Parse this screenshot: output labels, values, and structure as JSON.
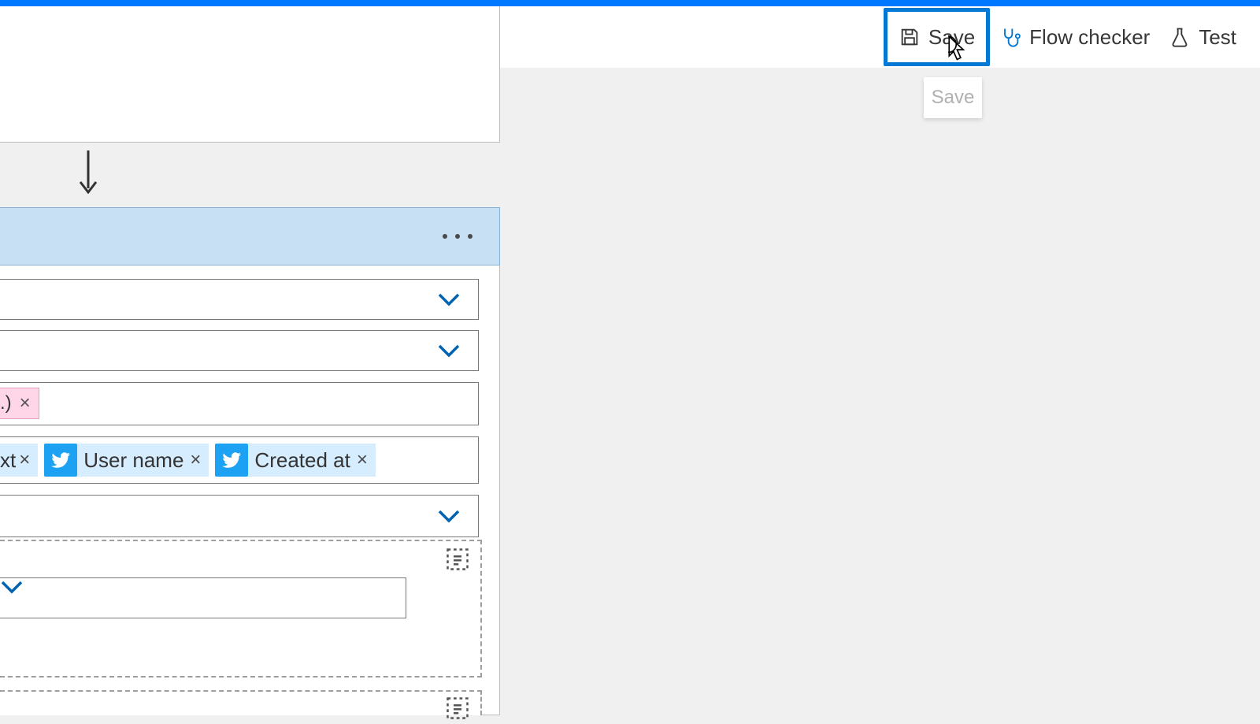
{
  "toolbar": {
    "save_label": "Save",
    "flow_checker_label": "Flow checker",
    "test_label": "Test"
  },
  "tooltip": {
    "save": "Save"
  },
  "action": {
    "tokens": {
      "partial_text": "xt",
      "user_name": "User name",
      "created_at": "Created at"
    },
    "pink_partial": ".)"
  }
}
